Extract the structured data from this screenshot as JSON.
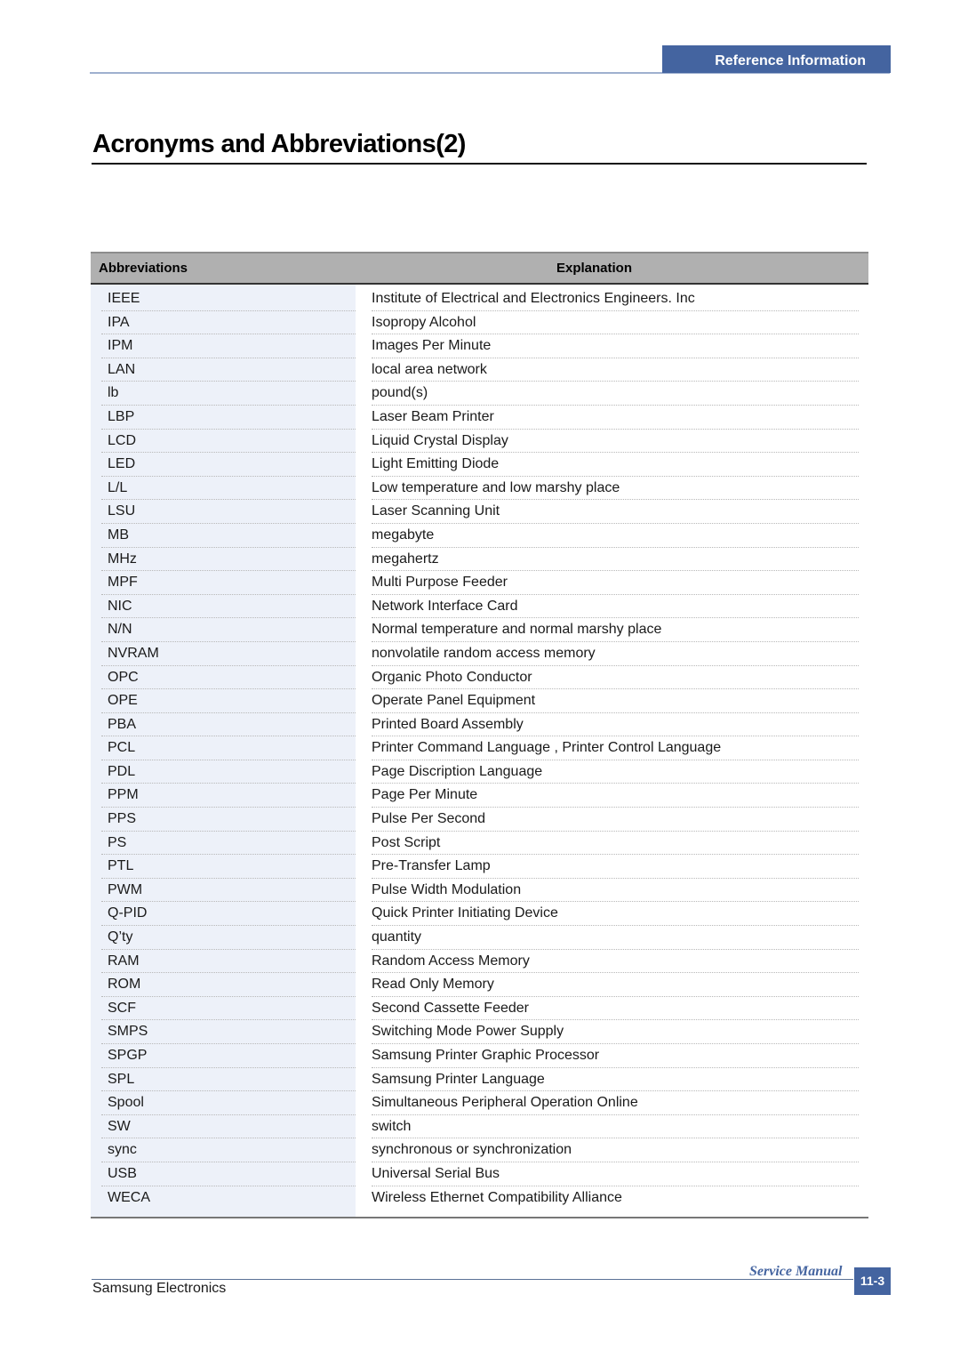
{
  "header": {
    "section_label": "Reference Information",
    "accent_color": "#4464a0"
  },
  "page_title": "Acronyms and Abbreviations(2)",
  "table": {
    "columns": [
      "Abbreviations",
      "Explanation"
    ],
    "rows": [
      {
        "abbr": "IEEE",
        "explanation": "Institute of Electrical and Electronics Engineers. Inc"
      },
      {
        "abbr": "IPA",
        "explanation": "Isopropy Alcohol"
      },
      {
        "abbr": "IPM",
        "explanation": "Images Per Minute"
      },
      {
        "abbr": "LAN",
        "explanation": "local area network"
      },
      {
        "abbr": "lb",
        "explanation": "pound(s)"
      },
      {
        "abbr": "LBP",
        "explanation": "Laser Beam Printer"
      },
      {
        "abbr": "LCD",
        "explanation": "Liquid Crystal Display"
      },
      {
        "abbr": "LED",
        "explanation": "Light Emitting Diode"
      },
      {
        "abbr": "L/L",
        "explanation": "Low temperature and low marshy place"
      },
      {
        "abbr": "LSU",
        "explanation": "Laser Scanning Unit"
      },
      {
        "abbr": "MB",
        "explanation": "megabyte"
      },
      {
        "abbr": "MHz",
        "explanation": "megahertz"
      },
      {
        "abbr": "MPF",
        "explanation": "Multi Purpose Feeder"
      },
      {
        "abbr": "NIC",
        "explanation": "Network Interface Card"
      },
      {
        "abbr": "N/N",
        "explanation": "Normal temperature and normal marshy place"
      },
      {
        "abbr": "NVRAM",
        "explanation": "nonvolatile random access memory"
      },
      {
        "abbr": "OPC",
        "explanation": "Organic Photo Conductor"
      },
      {
        "abbr": "OPE",
        "explanation": "Operate Panel Equipment"
      },
      {
        "abbr": "PBA",
        "explanation": "Printed Board Assembly"
      },
      {
        "abbr": "PCL",
        "explanation": "Printer Command Language ,  Printer Control Language"
      },
      {
        "abbr": "PDL",
        "explanation": "Page Discription Language"
      },
      {
        "abbr": "PPM",
        "explanation": "Page Per Minute"
      },
      {
        "abbr": "PPS",
        "explanation": "Pulse Per Second"
      },
      {
        "abbr": "PS",
        "explanation": "Post Script"
      },
      {
        "abbr": "PTL",
        "explanation": "Pre-Transfer Lamp"
      },
      {
        "abbr": "PWM",
        "explanation": "Pulse Width Modulation"
      },
      {
        "abbr": "Q-PID",
        "explanation": "Quick Printer Initiating Device"
      },
      {
        "abbr": "Q’ty",
        "explanation": "quantity"
      },
      {
        "abbr": "RAM",
        "explanation": "Random Access Memory"
      },
      {
        "abbr": "ROM",
        "explanation": "Read Only Memory"
      },
      {
        "abbr": "SCF",
        "explanation": "Second Cassette Feeder"
      },
      {
        "abbr": "SMPS",
        "explanation": "Switching Mode Power Supply"
      },
      {
        "abbr": "SPGP",
        "explanation": "Samsung Printer Graphic Processor"
      },
      {
        "abbr": "SPL",
        "explanation": "Samsung Printer Language"
      },
      {
        "abbr": "Spool",
        "explanation": "Simultaneous Peripheral Operation Online"
      },
      {
        "abbr": "SW",
        "explanation": "switch"
      },
      {
        "abbr": "sync",
        "explanation": "synchronous or synchronization"
      },
      {
        "abbr": "USB",
        "explanation": "Universal Serial Bus"
      },
      {
        "abbr": "WECA",
        "explanation": "Wireless Ethernet Compatibility Alliance"
      }
    ]
  },
  "footer": {
    "company": "Samsung Electronics",
    "manual_label": "Service Manual",
    "page_number": "11-3"
  }
}
